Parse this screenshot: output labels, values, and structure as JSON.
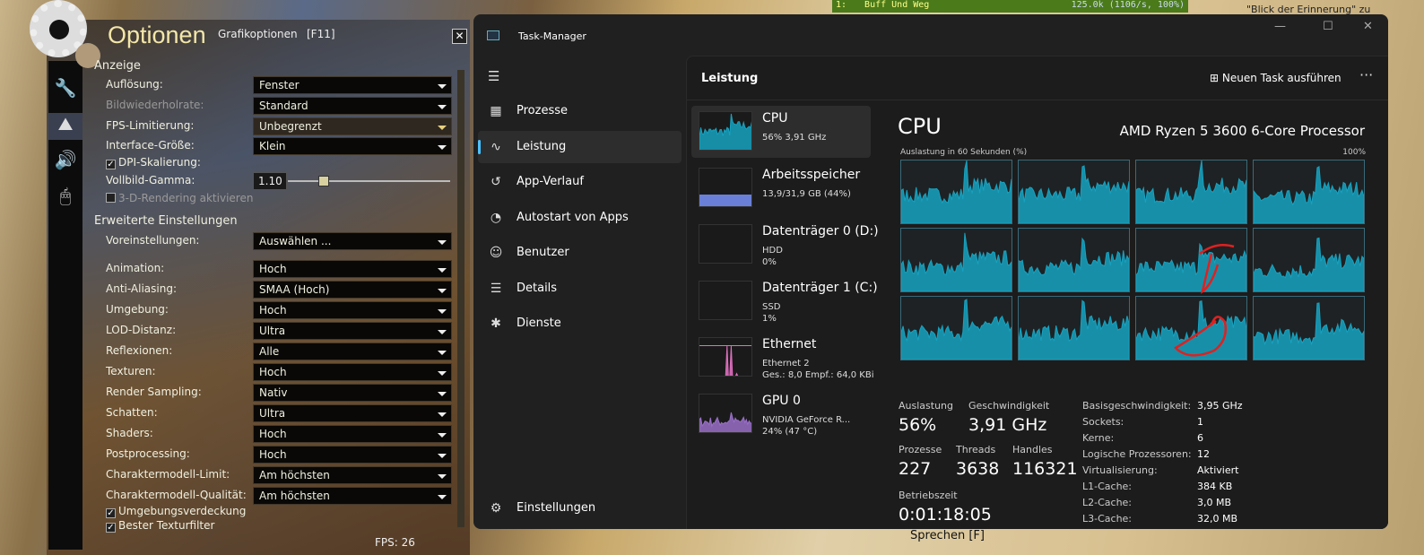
{
  "game": {
    "dps_meter": {
      "rank": "1:",
      "name": "Buff Und Weg",
      "value": "125.0k (1106/s, 100%)"
    },
    "chat_snippet": "\"Blick der Erinnerung\" zu",
    "speak_prompt": "Sprechen [F]",
    "fps": "FPS: 26",
    "options": {
      "title": "Optionen",
      "subtitle": "Grafikoptionen",
      "hotkey": "[F11]",
      "close": "✕",
      "tabs": [
        "wrench",
        "landscape",
        "speaker",
        "mouse"
      ],
      "sections": {
        "display": "Anzeige",
        "advanced": "Erweiterte Einstellungen"
      },
      "display": [
        {
          "label": "Auflösung:",
          "value": "Fenster"
        },
        {
          "label": "Bildwiederholrate:",
          "value": "Standard",
          "disabled": true
        },
        {
          "label": "FPS-Limitierung:",
          "value": "Unbegrenzt"
        },
        {
          "label": "Interface-Größe:",
          "value": "Klein"
        }
      ],
      "dpi": {
        "label": "DPI-Skalierung:",
        "checked": true
      },
      "gamma": {
        "label": "Vollbild-Gamma:",
        "value": "1.10",
        "fraction": 0.2
      },
      "render3d": {
        "label": "3-D-Rendering aktivieren",
        "checked": false
      },
      "preset": {
        "label": "Voreinstellungen:",
        "value": "Auswählen ..."
      },
      "advanced": [
        {
          "label": "Animation:",
          "value": "Hoch"
        },
        {
          "label": "Anti-Aliasing:",
          "value": "SMAA (Hoch)"
        },
        {
          "label": "Umgebung:",
          "value": "Hoch"
        },
        {
          "label": "LOD-Distanz:",
          "value": "Ultra"
        },
        {
          "label": "Reflexionen:",
          "value": "Alle"
        },
        {
          "label": "Texturen:",
          "value": "Hoch"
        },
        {
          "label": "Render Sampling:",
          "value": "Nativ"
        },
        {
          "label": "Schatten:",
          "value": "Ultra"
        },
        {
          "label": "Shaders:",
          "value": "Hoch"
        },
        {
          "label": "Postprocessing:",
          "value": "Hoch"
        },
        {
          "label": "Charaktermodell-Limit:",
          "value": "Am höchsten"
        },
        {
          "label": "Charaktermodell-Qualität:",
          "value": "Am höchsten"
        }
      ],
      "checkboxes": [
        {
          "label": "Umgebungsverdeckung",
          "checked": true
        },
        {
          "label": "Bester Texturfilter",
          "checked": true
        }
      ]
    }
  },
  "taskmanager": {
    "title": "Task-Manager",
    "window_buttons": {
      "minimize": "—",
      "maximize": "☐",
      "close": "✕"
    },
    "nav": [
      {
        "label": "Prozesse",
        "icon": "grid-icon"
      },
      {
        "label": "Leistung",
        "icon": "performance-icon",
        "active": true
      },
      {
        "label": "App-Verlauf",
        "icon": "history-icon"
      },
      {
        "label": "Autostart von Apps",
        "icon": "speedometer-icon"
      },
      {
        "label": "Benutzer",
        "icon": "users-icon"
      },
      {
        "label": "Details",
        "icon": "list-icon"
      },
      {
        "label": "Dienste",
        "icon": "puzzle-icon"
      }
    ],
    "settings": "Einstellungen",
    "header": "Leistung",
    "new_task": "Neuen Task ausführen",
    "more": "···",
    "devices": [
      {
        "name": "CPU",
        "l1": "56% 3,91 GHz",
        "l2": "",
        "color": "#17a2c0",
        "level": 0.56
      },
      {
        "name": "Arbeitsspeicher",
        "l1": "13,9/31,9 GB (44%)",
        "l2": "",
        "color": "#6a7fd8",
        "level": 0.44
      },
      {
        "name": "Datenträger 0 (D:)",
        "l1": "HDD",
        "l2": "0%",
        "color": "#5a9a50",
        "level": 0
      },
      {
        "name": "Datenträger 1 (C:)",
        "l1": "SSD",
        "l2": "1%",
        "color": "#5a9a50",
        "level": 0.01
      },
      {
        "name": "Ethernet",
        "l1": "Ethernet 2",
        "l2": "Ges.: 8,0 Empf.: 64,0 KBi",
        "color": "#e070c0",
        "level": 0.05
      },
      {
        "name": "GPU 0",
        "l1": "NVIDIA GeForce R...",
        "l2": "24% (47 °C)",
        "color": "#9a70c8",
        "level": 0.24
      }
    ],
    "cpu": {
      "title": "CPU",
      "model": "AMD Ryzen 5 3600 6-Core Processor",
      "graph_label": "Auslastung in 60 Sekunden (%)",
      "graph_max": "100%",
      "stats": {
        "util_label": "Auslastung",
        "util": "56%",
        "speed_label": "Geschwindigkeit",
        "speed": "3,91 GHz",
        "proc_label": "Prozesse",
        "proc": "227",
        "threads_label": "Threads",
        "threads": "3638",
        "handles_label": "Handles",
        "handles": "116321",
        "uptime_label": "Betriebszeit",
        "uptime": "0:01:18:05"
      },
      "specs": [
        {
          "k": "Basisgeschwindigkeit:",
          "v": "3,95 GHz"
        },
        {
          "k": "Sockets:",
          "v": "1"
        },
        {
          "k": "Kerne:",
          "v": "6"
        },
        {
          "k": "Logische Prozessoren:",
          "v": "12"
        },
        {
          "k": "Virtualisierung:",
          "v": "Aktiviert"
        },
        {
          "k": "L1-Cache:",
          "v": "384 KB"
        },
        {
          "k": "L2-Cache:",
          "v": "3,0 MB"
        },
        {
          "k": "L3-Cache:",
          "v": "32,0 MB"
        }
      ]
    }
  }
}
